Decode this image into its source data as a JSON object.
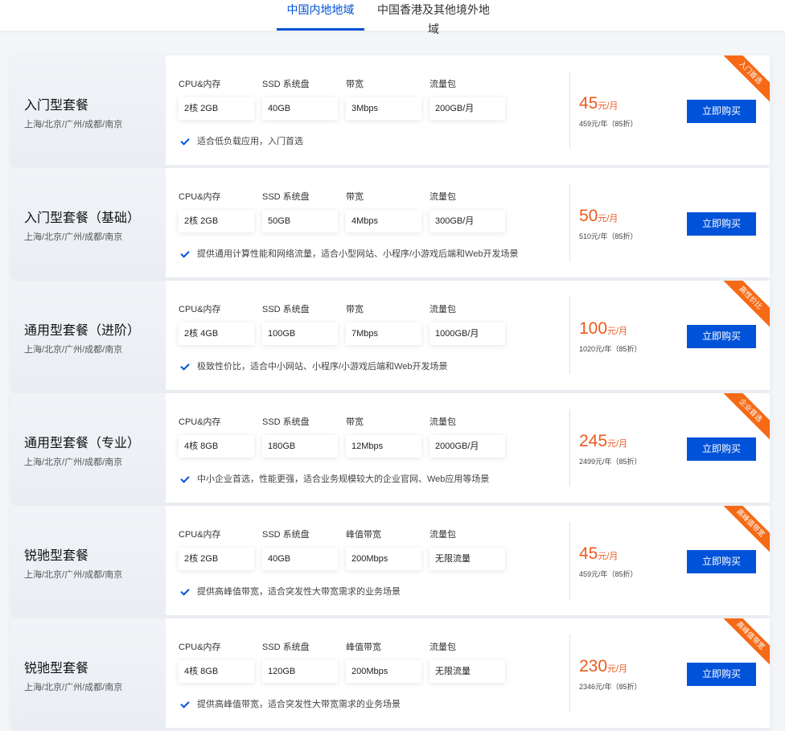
{
  "tabs": [
    {
      "label": "中国内地地域",
      "active": true
    },
    {
      "label": "中国香港及其他境外地域",
      "active": false
    }
  ],
  "colors": {
    "accent": "#0052d9",
    "price": "#ed5a1e",
    "ribbon": "#f66a16"
  },
  "check_icon": "check-icon",
  "plans": [
    {
      "name": "入门型套餐",
      "regions": "上海/北京/广州/成都/南京",
      "specs": [
        {
          "label": "CPU&内存",
          "value": "2核 2GB"
        },
        {
          "label": "SSD 系统盘",
          "value": "40GB"
        },
        {
          "label": "带宽",
          "value": "3Mbps"
        },
        {
          "label": "流量包",
          "value": "200GB/月"
        }
      ],
      "desc": "适合低负载应用，入门首选",
      "price": "45",
      "price_unit": "元/月",
      "price_year": "459元/年（85折）",
      "buy_label": "立即购买",
      "ribbon": "入门首选"
    },
    {
      "name": "入门型套餐（基础）",
      "regions": "上海/北京/广州/成都/南京",
      "specs": [
        {
          "label": "CPU&内存",
          "value": "2核 2GB"
        },
        {
          "label": "SSD 系统盘",
          "value": "50GB"
        },
        {
          "label": "带宽",
          "value": "4Mbps"
        },
        {
          "label": "流量包",
          "value": "300GB/月"
        }
      ],
      "desc": "提供通用计算性能和网络流量，适合小型网站、小程序/小游戏后端和Web开发场景",
      "price": "50",
      "price_unit": "元/月",
      "price_year": "510元/年（85折）",
      "buy_label": "立即购买",
      "ribbon": ""
    },
    {
      "name": "通用型套餐（进阶）",
      "regions": "上海/北京/广州/成都/南京",
      "specs": [
        {
          "label": "CPU&内存",
          "value": "2核 4GB"
        },
        {
          "label": "SSD 系统盘",
          "value": "100GB"
        },
        {
          "label": "带宽",
          "value": "7Mbps"
        },
        {
          "label": "流量包",
          "value": "1000GB/月"
        }
      ],
      "desc": "极致性价比，适合中小网站、小程序/小游戏后端和Web开发场景",
      "price": "100",
      "price_unit": "元/月",
      "price_year": "1020元/年（85折）",
      "buy_label": "立即购买",
      "ribbon": "高性价比"
    },
    {
      "name": "通用型套餐（专业）",
      "regions": "上海/北京/广州/成都/南京",
      "specs": [
        {
          "label": "CPU&内存",
          "value": "4核 8GB"
        },
        {
          "label": "SSD 系统盘",
          "value": "180GB"
        },
        {
          "label": "带宽",
          "value": "12Mbps"
        },
        {
          "label": "流量包",
          "value": "2000GB/月"
        }
      ],
      "desc": "中小企业首选，性能更强，适合业务规模较大的企业官网、Web应用等场景",
      "price": "245",
      "price_unit": "元/月",
      "price_year": "2499元/年（85折）",
      "buy_label": "立即购买",
      "ribbon": "企业首选"
    },
    {
      "name": "锐驰型套餐",
      "regions": "上海/北京/广州/成都/南京",
      "specs": [
        {
          "label": "CPU&内存",
          "value": "2核 2GB"
        },
        {
          "label": "SSD 系统盘",
          "value": "40GB"
        },
        {
          "label": "峰值带宽",
          "value": "200Mbps"
        },
        {
          "label": "流量包",
          "value": "无限流量"
        }
      ],
      "desc": "提供高峰值带宽，适合突发性大带宽需求的业务场景",
      "price": "45",
      "price_unit": "元/月",
      "price_year": "459元/年（85折）",
      "buy_label": "立即购买",
      "ribbon": "高峰值带宽"
    },
    {
      "name": "锐驰型套餐",
      "regions": "上海/北京/广州/成都/南京",
      "specs": [
        {
          "label": "CPU&内存",
          "value": "4核 8GB"
        },
        {
          "label": "SSD 系统盘",
          "value": "120GB"
        },
        {
          "label": "峰值带宽",
          "value": "200Mbps"
        },
        {
          "label": "流量包",
          "value": "无限流量"
        }
      ],
      "desc": "提供高峰值带宽，适合突发性大带宽需求的业务场景",
      "price": "230",
      "price_unit": "元/月",
      "price_year": "2346元/年（85折）",
      "buy_label": "立即购买",
      "ribbon": "高峰值带宽"
    }
  ]
}
